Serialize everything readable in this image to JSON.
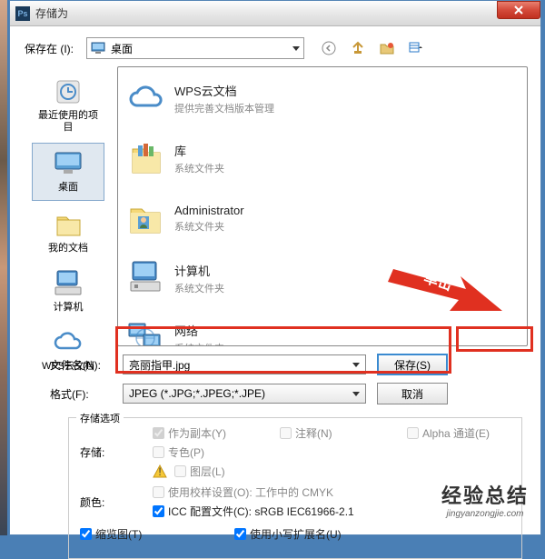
{
  "title": "存储为",
  "saveInLabel": "保存在 (I):",
  "saveInValue": "桌面",
  "sidebar": [
    {
      "label": "最近使用的项目"
    },
    {
      "label": "桌面"
    },
    {
      "label": "我的文档"
    },
    {
      "label": "计算机"
    },
    {
      "label": "WPS云文档"
    }
  ],
  "fileList": [
    {
      "title": "WPS云文档",
      "sub": "提供完善文档版本管理"
    },
    {
      "title": "库",
      "sub": "系统文件夹"
    },
    {
      "title": "Administrator",
      "sub": "系统文件夹"
    },
    {
      "title": "计算机",
      "sub": "系统文件夹"
    },
    {
      "title": "网络",
      "sub": "系统文件夹"
    }
  ],
  "filenameLabel": "文件名(N):",
  "filenameValue": "亮丽指甲.jpg",
  "formatLabel": "格式(F):",
  "formatValue": "JPEG (*.JPG;*.JPEG;*.JPE)",
  "saveBtn": "保存(S)",
  "cancelBtn": "取消",
  "arrowText": "单击",
  "options": {
    "title": "存储选项",
    "storeLabel": "存储:",
    "colorLabel": "颜色:",
    "asCopy": "作为副本(Y)",
    "notes": "注释(N)",
    "alpha": "Alpha 通道(E)",
    "spot": "专色(P)",
    "layers": "图层(L)",
    "proof": "使用校样设置(O):",
    "proofVal": "工作中的 CMYK",
    "icc": "ICC 配置文件(C):",
    "iccVal": "sRGB IEC61966-2.1",
    "thumb": "缩览图(T)",
    "lowerExt": "使用小写扩展名(U)"
  },
  "watermark": {
    "main": "经验总结",
    "sub": "jingyanzongjie.com"
  }
}
